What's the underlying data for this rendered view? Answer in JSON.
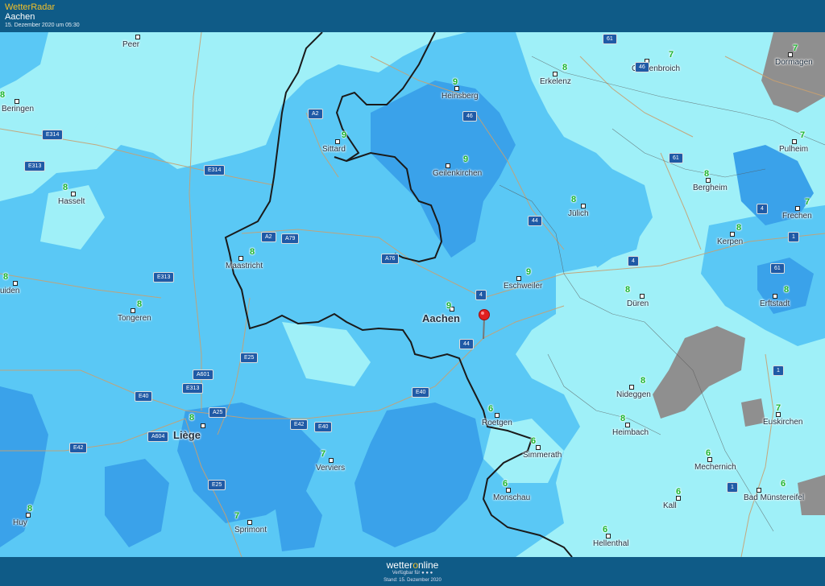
{
  "header": {
    "brand": "WetterRadar",
    "title": "Aachen",
    "timestamp": "15. Dezember 2020 um 05:30"
  },
  "footer": {
    "logo_pre": "wetter",
    "logo_o": "o",
    "logo_post": "nline",
    "available_label": "Verfügbar für",
    "stand": "Stand: 15. Dezember 2020"
  },
  "colors": {
    "light_rain": "#9ff0f8",
    "moderate_rain": "#5ac8f5",
    "heavy_rain": "#3aa2ea",
    "clouds": "#8f8f8f",
    "temperature": "#1db52e",
    "road_shield": "#1f5aa6",
    "border": "#1a1a1a"
  },
  "places": [
    {
      "name": "Peer",
      "temp": ""
    },
    {
      "name": "Beringen",
      "temp": "8"
    },
    {
      "name": "Hasselt",
      "temp": "8"
    },
    {
      "name": "uiden",
      "temp": "8"
    },
    {
      "name": "Tongeren",
      "temp": "8"
    },
    {
      "name": "Maastricht",
      "temp": "8"
    },
    {
      "name": "Sittard",
      "temp": "9"
    },
    {
      "name": "Heinsberg",
      "temp": "9"
    },
    {
      "name": "Geilenkirchen",
      "temp": "9"
    },
    {
      "name": "Erkelenz",
      "temp": "8"
    },
    {
      "name": "Grevenbroich",
      "temp": "7"
    },
    {
      "name": "Dormagen",
      "temp": "7"
    },
    {
      "name": "Pulheim",
      "temp": "7"
    },
    {
      "name": "Bergheim",
      "temp": "8"
    },
    {
      "name": "Frechen",
      "temp": "7"
    },
    {
      "name": "Kerpen",
      "temp": "8"
    },
    {
      "name": "Jülich",
      "temp": "8"
    },
    {
      "name": "Eschweiler",
      "temp": "9"
    },
    {
      "name": "Aachen",
      "temp": "9"
    },
    {
      "name": "Düren",
      "temp": "8"
    },
    {
      "name": "Erftstadt",
      "temp": "8"
    },
    {
      "name": "Nideggen",
      "temp": "8"
    },
    {
      "name": "Euskirchen",
      "temp": "7"
    },
    {
      "name": "Heimbach",
      "temp": "8"
    },
    {
      "name": "Roetgen",
      "temp": "6"
    },
    {
      "name": "Simmerath",
      "temp": "6"
    },
    {
      "name": "Mechernich",
      "temp": "6"
    },
    {
      "name": "Monschau",
      "temp": "6"
    },
    {
      "name": "Kall",
      "temp": "6"
    },
    {
      "name": "Bad Münstereifel",
      "temp": "6"
    },
    {
      "name": "Hellenthal",
      "temp": "6"
    },
    {
      "name": "Liège",
      "temp": "8"
    },
    {
      "name": "Verviers",
      "temp": "7"
    },
    {
      "name": "Huy",
      "temp": "8"
    },
    {
      "name": "Sprimont",
      "temp": "7"
    }
  ],
  "roads": [
    "61",
    "46",
    "A2",
    "46",
    "E314",
    "E314",
    "E313",
    "61",
    "A2",
    "A79",
    "A76",
    "44",
    "4",
    "4",
    "1",
    "61",
    "4",
    "E313",
    "44",
    "E25",
    "A601",
    "E313",
    "E40",
    "A25",
    "E40",
    "E42",
    "E40",
    "E42",
    "A604",
    "E25",
    "1",
    "1"
  ]
}
